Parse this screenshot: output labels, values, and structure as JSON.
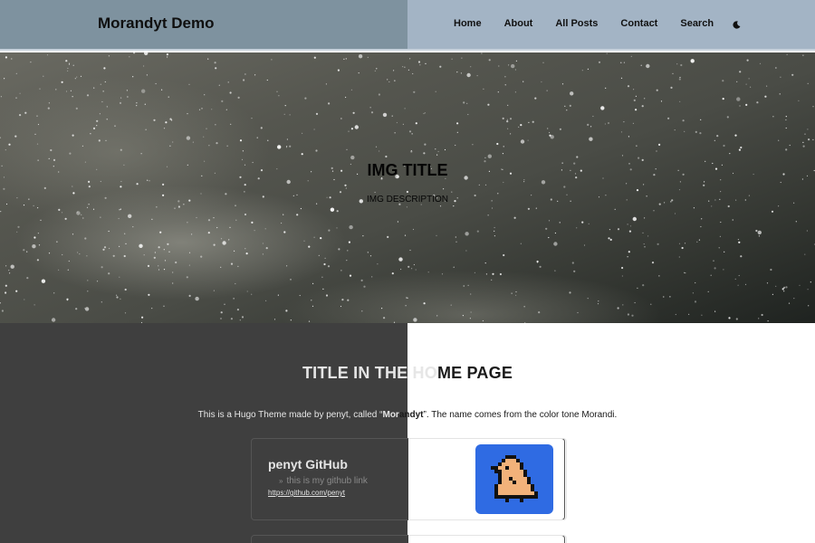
{
  "brand": "Morandyt Demo",
  "nav": {
    "items": [
      {
        "label": "Home"
      },
      {
        "label": "About"
      },
      {
        "label": "All Posts"
      },
      {
        "label": "Contact"
      },
      {
        "label": "Search"
      }
    ],
    "theme_toggle_icon": "moon-icon"
  },
  "hero": {
    "title": "IMG TITLE",
    "description": "IMG DESCRIPTION"
  },
  "main": {
    "title": "TITLE IN THE HOME PAGE",
    "intro_before": "This is a Hugo Theme made by penyt, called “",
    "intro_bold": "Morandyt",
    "intro_after": "”. The name comes from the color tone Morandi."
  },
  "card": {
    "title": "penyt GitHub",
    "subtitle": "this is my github link",
    "subtitle_icon": "double-arrow-icon",
    "link": "https://github.com/penyt",
    "avatar_icon": "pixel-bird-avatar"
  },
  "colors": {
    "nav_left": "#7e929f",
    "nav_right": "#a3b4c5",
    "dark_bg": "#3f3f3f",
    "avatar_bg": "#2f6be3",
    "avatar_bird": "#f2b27a"
  }
}
